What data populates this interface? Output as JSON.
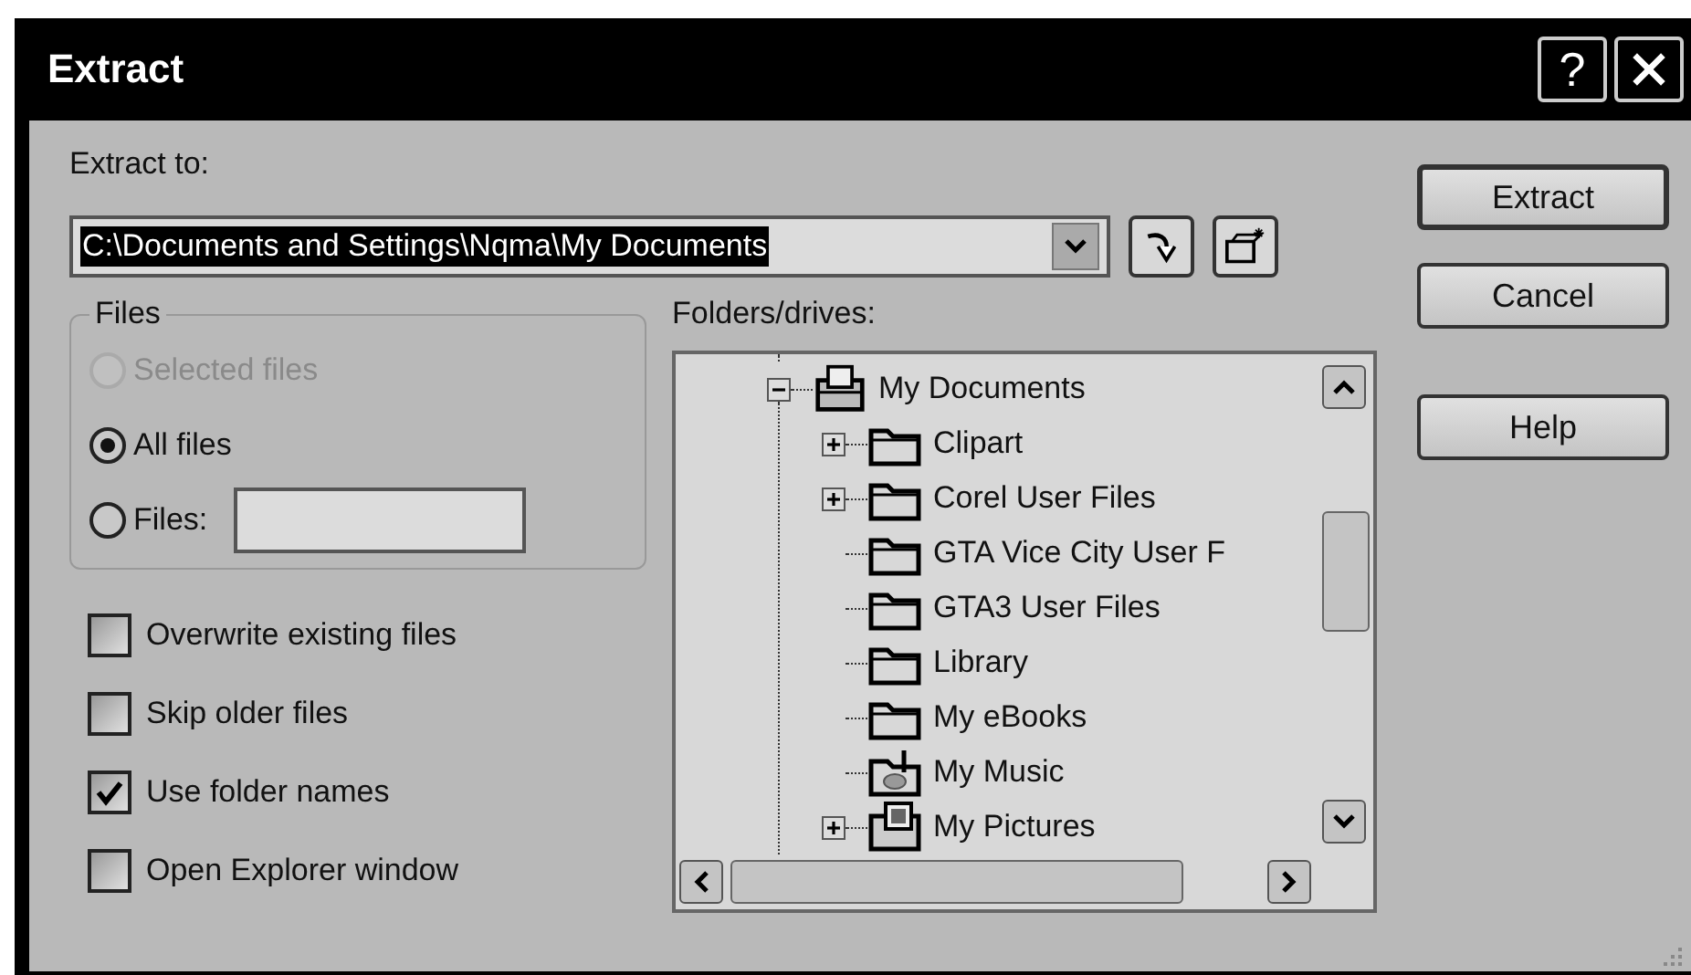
{
  "window": {
    "title": "Extract",
    "help_button": "?"
  },
  "extract_to": {
    "label": "Extract to:",
    "value": "C:\\Documents and Settings\\Nqma\\My Documents"
  },
  "files_group": {
    "title": "Files",
    "choices": [
      {
        "label": "Selected files",
        "selected": false,
        "disabled": true,
        "kind": "plain"
      },
      {
        "label": "All files",
        "selected": true,
        "disabled": false,
        "kind": "plain"
      },
      {
        "label": "Files:",
        "selected": false,
        "disabled": false,
        "kind": "with_field"
      }
    ]
  },
  "options": [
    {
      "label": "Overwrite existing files",
      "checked": false
    },
    {
      "label": "Skip older files",
      "checked": false
    },
    {
      "label": "Use folder names",
      "checked": true
    },
    {
      "label": "Open Explorer window",
      "checked": false
    }
  ],
  "folders": {
    "label": "Folders/drives:",
    "tree": [
      {
        "label": "My Documents",
        "kind": "documents",
        "expanded": true,
        "children": [
          {
            "label": "Clipart",
            "kind": "folder",
            "expanded": false
          },
          {
            "label": "Corel User Files",
            "kind": "folder",
            "expanded": false
          },
          {
            "label": "GTA Vice City User F",
            "kind": "folder"
          },
          {
            "label": "GTA3 User Files",
            "kind": "folder"
          },
          {
            "label": "Library",
            "kind": "folder"
          },
          {
            "label": "My eBooks",
            "kind": "folder"
          },
          {
            "label": "My Music",
            "kind": "music"
          },
          {
            "label": "My Pictures",
            "kind": "pictures",
            "expanded": false
          }
        ]
      }
    ]
  },
  "buttons": [
    {
      "label": "Extract",
      "default": true
    },
    {
      "label": "Cancel",
      "default": false
    }
  ],
  "help_button": "Help"
}
